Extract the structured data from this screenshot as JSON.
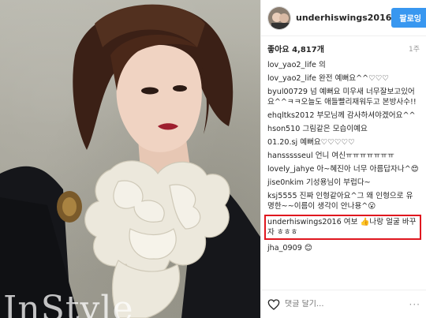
{
  "photo": {
    "magazine_logo": "InStyle"
  },
  "header": {
    "username": "underhiswings2016",
    "follow_label": "팔로잉"
  },
  "likes": {
    "text": "좋아요 4,817개",
    "time": "1주"
  },
  "comments": [
    {
      "user": "lov_yao2_life",
      "text": "의"
    },
    {
      "user": "lov_yao2_life",
      "text": "완전 예뻐요^^♡♡♡"
    },
    {
      "user": "byul00729",
      "text": "넘 예뻐요 미우새 너무잘보고있어요^^ㅋㅋ오늘도 애들빨리재워두고 본방사수!!"
    },
    {
      "user": "ehqltks2012",
      "text": "부모님께 감사하셔야겠어요^^"
    },
    {
      "user": "hson510",
      "text": "그림같은 모습이예요"
    },
    {
      "user": "01.20.sj",
      "text": "예뻐요♡♡♡♡♡"
    },
    {
      "user": "hanssssseul",
      "text": "언니 여신ㅠㅠㅠㅠㅠㅠㅠ"
    },
    {
      "user": "lovely_jahye",
      "text": "아~혜진아 너무 아름답자나^😍"
    },
    {
      "user": "jise0nkim",
      "text": "기성용님이 부럽다~"
    },
    {
      "user": "ksj5555",
      "text": "진짜 인형같아요^그 왜 인형으로 유명한~~이름이 생각이 안나용^😮"
    },
    {
      "user": "underhiswings2016",
      "text": "여보 👍나랑 얼굴 바꾸자 ㅎㅎㅎ",
      "highlight": true
    },
    {
      "user": "jha_0909",
      "text": "😊"
    }
  ],
  "footer": {
    "comment_placeholder": "댓글 달기...",
    "more": "···"
  },
  "colors": {
    "accent": "#3897f0",
    "highlight_border": "#e0171f"
  }
}
